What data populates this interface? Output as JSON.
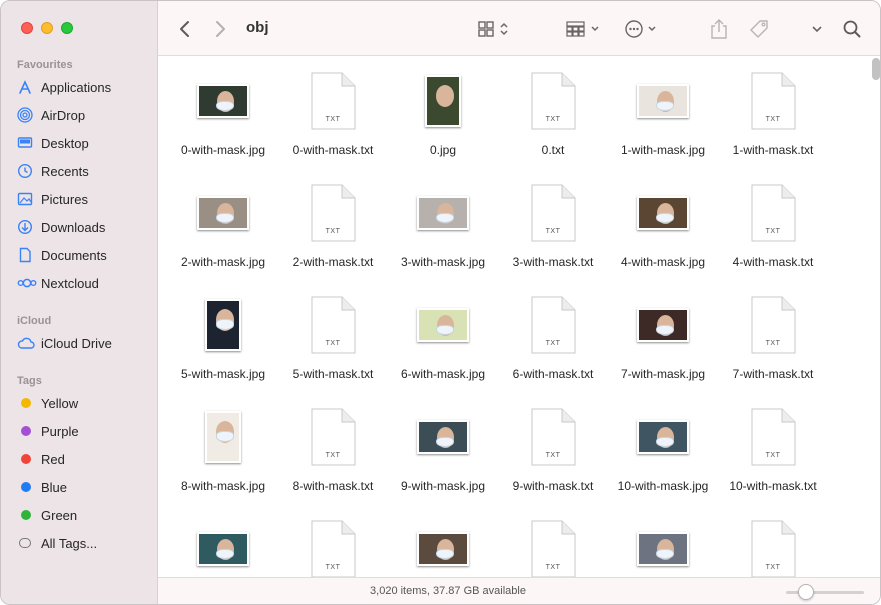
{
  "window": {
    "title": "obj"
  },
  "sidebar": {
    "favourites_heading": "Favourites",
    "favourites": [
      {
        "label": "Applications",
        "icon": "applications-icon"
      },
      {
        "label": "AirDrop",
        "icon": "airdrop-icon"
      },
      {
        "label": "Desktop",
        "icon": "desktop-icon"
      },
      {
        "label": "Recents",
        "icon": "recents-icon"
      },
      {
        "label": "Pictures",
        "icon": "pictures-icon"
      },
      {
        "label": "Downloads",
        "icon": "downloads-icon"
      },
      {
        "label": "Documents",
        "icon": "documents-icon"
      },
      {
        "label": "Nextcloud",
        "icon": "nextcloud-icon"
      }
    ],
    "icloud_heading": "iCloud",
    "icloud": [
      {
        "label": "iCloud Drive",
        "icon": "icloud-icon"
      }
    ],
    "tags_heading": "Tags",
    "tags": [
      {
        "label": "Yellow",
        "color": "#f5b800"
      },
      {
        "label": "Purple",
        "color": "#a450d6"
      },
      {
        "label": "Red",
        "color": "#f2433b"
      },
      {
        "label": "Blue",
        "color": "#1f7cf5"
      },
      {
        "label": "Green",
        "color": "#2fb43a"
      },
      {
        "label": "All Tags...",
        "color": ""
      }
    ]
  },
  "toolbar": {
    "back_icon": "chevron-left-icon",
    "forward_icon": "chevron-right-icon",
    "view_icon": "grid-view-icon",
    "group_icon": "group-icon",
    "action_icon": "more-actions-icon",
    "share_icon": "share-icon",
    "tag_icon": "tag-icon",
    "search_icon": "search-icon"
  },
  "files": [
    {
      "name": "0-with-mask.jpg",
      "kind": "image",
      "bg": "#2f3a30",
      "mask": true
    },
    {
      "name": "0-with-mask.txt",
      "kind": "text",
      "label": "TXT"
    },
    {
      "name": "0.jpg",
      "kind": "image",
      "bg": "#3b4a2f",
      "mask": false
    },
    {
      "name": "0.txt",
      "kind": "text",
      "label": "TXT"
    },
    {
      "name": "1-with-mask.jpg",
      "kind": "image",
      "bg": "#e9e5de",
      "mask": true
    },
    {
      "name": "1-with-mask.txt",
      "kind": "text",
      "label": "TXT"
    },
    {
      "name": "2-with-mask.jpg",
      "kind": "image",
      "bg": "#9a8f84",
      "mask": true
    },
    {
      "name": "2-with-mask.txt",
      "kind": "text",
      "label": "TXT"
    },
    {
      "name": "3-with-mask.jpg",
      "kind": "image",
      "bg": "#b7b1ad",
      "mask": true
    },
    {
      "name": "3-with-mask.txt",
      "kind": "text",
      "label": "TXT"
    },
    {
      "name": "4-with-mask.jpg",
      "kind": "image",
      "bg": "#5a4632",
      "mask": true
    },
    {
      "name": "4-with-mask.txt",
      "kind": "text",
      "label": "TXT"
    },
    {
      "name": "5-with-mask.jpg",
      "kind": "image",
      "bg": "#1d2430",
      "mask": true
    },
    {
      "name": "5-with-mask.txt",
      "kind": "text",
      "label": "TXT"
    },
    {
      "name": "6-with-mask.jpg",
      "kind": "image",
      "bg": "#d8e2b4",
      "mask": true
    },
    {
      "name": "6-with-mask.txt",
      "kind": "text",
      "label": "TXT"
    },
    {
      "name": "7-with-mask.jpg",
      "kind": "image",
      "bg": "#3d2a26",
      "mask": true
    },
    {
      "name": "7-with-mask.txt",
      "kind": "text",
      "label": "TXT"
    },
    {
      "name": "8-with-mask.jpg",
      "kind": "image",
      "bg": "#f1ebe6",
      "mask": true
    },
    {
      "name": "8-with-mask.txt",
      "kind": "text",
      "label": "TXT"
    },
    {
      "name": "9-with-mask.jpg",
      "kind": "image",
      "bg": "#3d4d55",
      "mask": true
    },
    {
      "name": "9-with-mask.txt",
      "kind": "text",
      "label": "TXT"
    },
    {
      "name": "10-with-mask.jpg",
      "kind": "image",
      "bg": "#3f5561",
      "mask": true
    },
    {
      "name": "10-with-mask.txt",
      "kind": "text",
      "label": "TXT"
    },
    {
      "name": "",
      "kind": "image",
      "bg": "#2f5a60",
      "mask": true
    },
    {
      "name": "",
      "kind": "text",
      "label": "TXT"
    },
    {
      "name": "",
      "kind": "image",
      "bg": "#5b4b3f",
      "mask": true
    },
    {
      "name": "",
      "kind": "text",
      "label": "TXT"
    },
    {
      "name": "",
      "kind": "image",
      "bg": "#6d7380",
      "mask": true
    },
    {
      "name": "",
      "kind": "text",
      "label": "TXT"
    }
  ],
  "status": {
    "text": "3,020 items, 37.87 GB available",
    "zoom": 0.25
  }
}
